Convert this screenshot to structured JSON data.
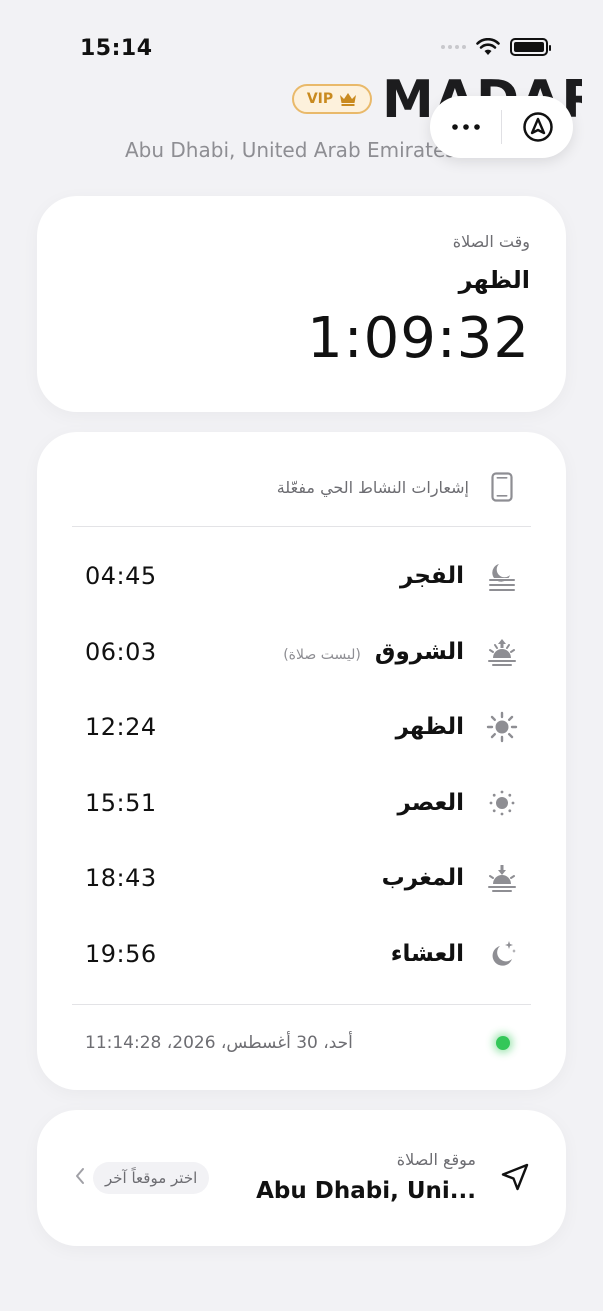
{
  "status_bar": {
    "time": "15:14"
  },
  "header": {
    "app_title": "MADAR",
    "vip_label": "VIP",
    "subtitle": "Abu Dhabi, United Arab Emirates"
  },
  "countdown": {
    "label": "وقت الصلاة",
    "prayer": "الظهر",
    "time": "1:09:32"
  },
  "prayer_times": {
    "notification_text": "إشعارات النشاط الحي مفعّلة",
    "items": [
      {
        "name": "الفجر",
        "note": "",
        "time": "04:45",
        "icon": "fajr-moon-icon"
      },
      {
        "name": "الشروق",
        "note": "(ليست صلاة)",
        "time": "06:03",
        "icon": "sunrise-icon"
      },
      {
        "name": "الظهر",
        "note": "",
        "time": "12:24",
        "icon": "sun-icon"
      },
      {
        "name": "العصر",
        "note": "",
        "time": "15:51",
        "icon": "sun-small-icon"
      },
      {
        "name": "المغرب",
        "note": "",
        "time": "18:43",
        "icon": "sunset-icon"
      },
      {
        "name": "العشاء",
        "note": "",
        "time": "19:56",
        "icon": "moon-stars-icon"
      }
    ],
    "footer_date": "أحد، 30 أغسطس، 2026، 11:14:28"
  },
  "location": {
    "label": "موقع الصلاة",
    "name": "Abu Dhabi, Uni...",
    "choose_label": "اختر موقعاً آخر"
  },
  "colors": {
    "background": "#f2f2f5",
    "card": "#ffffff",
    "vip_gold": "#c98a1f",
    "live_green": "#34c759"
  }
}
